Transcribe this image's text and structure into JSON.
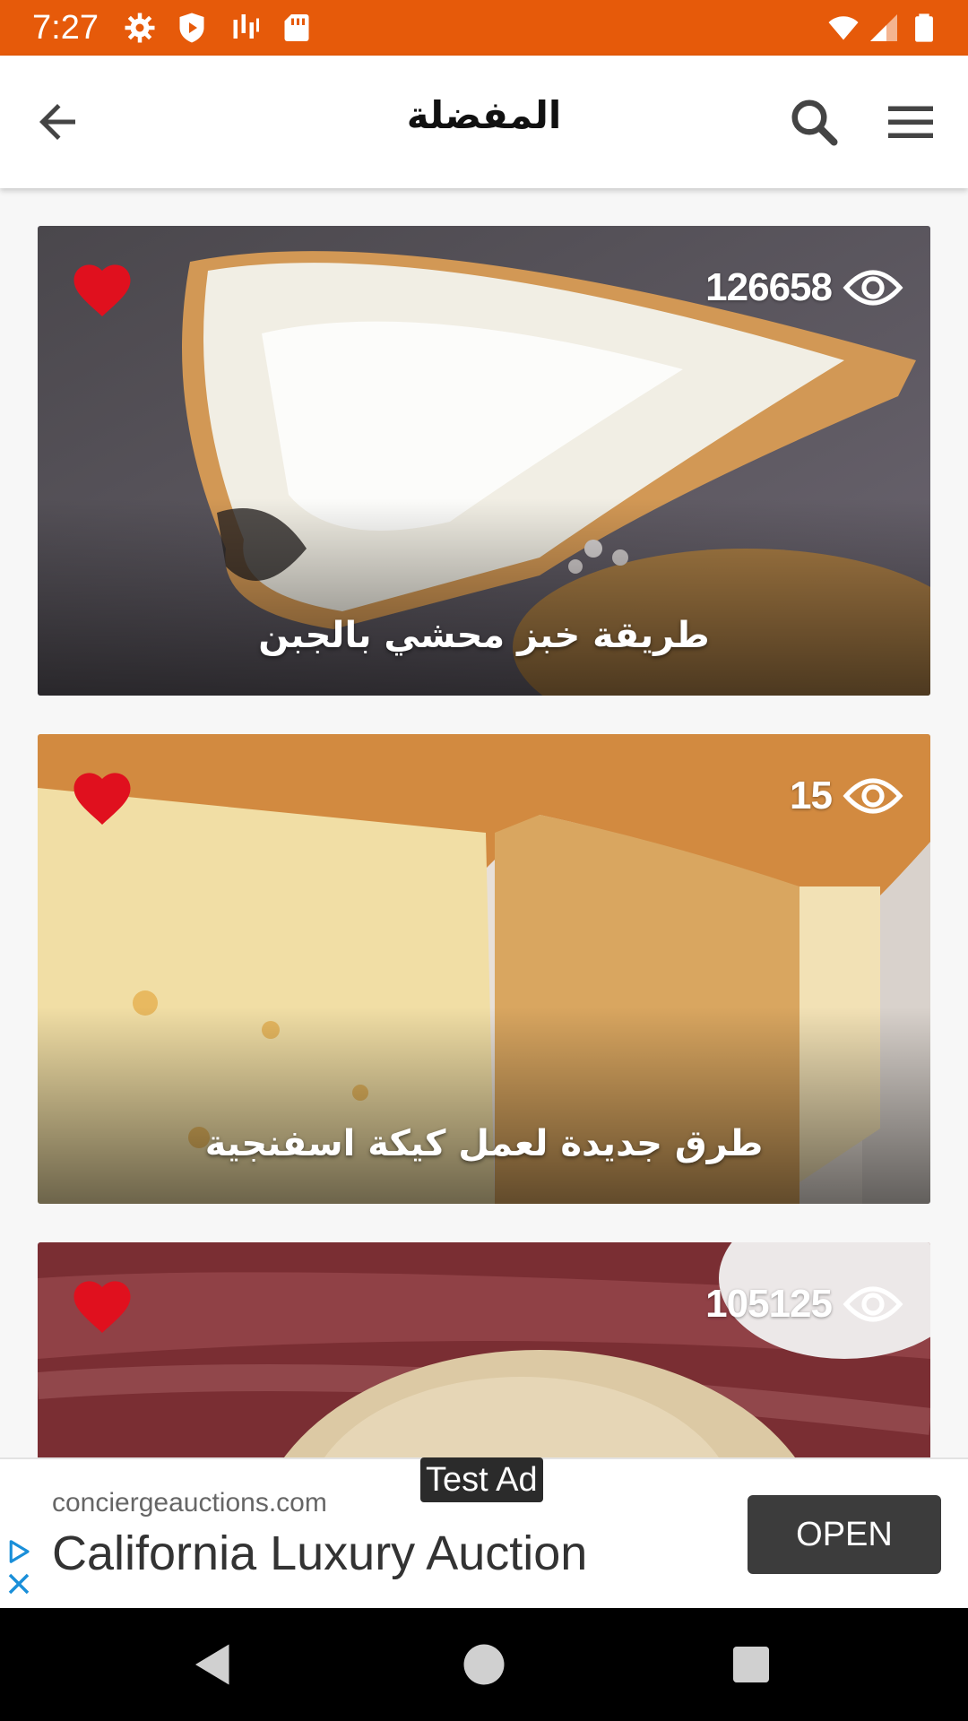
{
  "status_bar": {
    "time": "7:27",
    "left_icons": [
      "settings-icon",
      "shield-play-icon",
      "signal-bars-icon",
      "sd-card-icon"
    ],
    "right_icons": [
      "wifi-icon",
      "cell-signal-icon",
      "battery-icon"
    ],
    "background_color": "#e65a0a"
  },
  "app_bar": {
    "title": "المفضلة",
    "back_icon": "arrow-back-icon",
    "search_icon": "search-icon",
    "menu_icon": "menu-icon"
  },
  "cards": [
    {
      "title": "طريقة خبز محشي بالجبن",
      "views": "126658",
      "favorite": true,
      "image": "stuffed-cheese-bread"
    },
    {
      "title": "طرق جديدة لعمل كيكة اسفنجية",
      "views": "15",
      "favorite": true,
      "image": "sponge-cake"
    },
    {
      "title": "",
      "views": "105125",
      "favorite": true,
      "image": "dough-ball"
    }
  ],
  "ad": {
    "badge": "Test Ad",
    "domain": "conciergeauctions.com",
    "headline": "California Luxury Auction",
    "cta": "OPEN"
  },
  "nav_bar": {
    "icons": [
      "back-triangle-icon",
      "home-circle-icon",
      "recents-square-icon"
    ]
  }
}
